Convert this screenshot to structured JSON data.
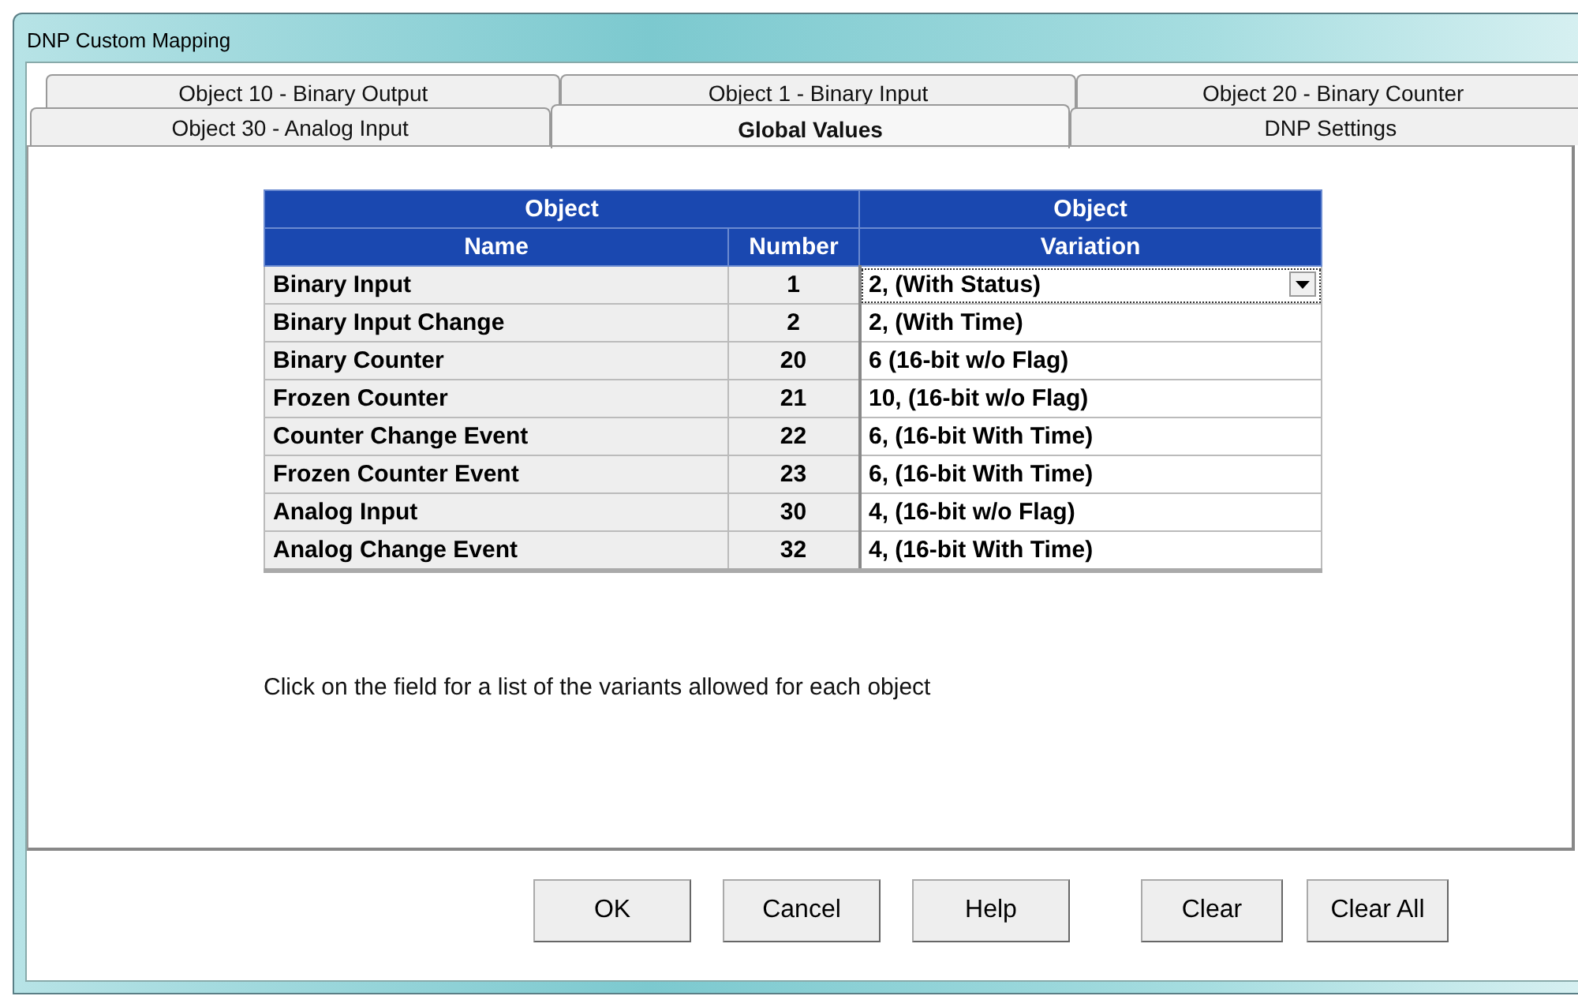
{
  "window": {
    "title": "DNP Custom Mapping"
  },
  "tab_rows": [
    [
      {
        "label": "Object 10 - Binary Output",
        "selected": false
      },
      {
        "label": "Object 1 - Binary Input",
        "selected": false
      },
      {
        "label": "Object 20 - Binary Counter",
        "selected": false
      }
    ],
    [
      {
        "label": "Object 30 - Analog Input",
        "selected": false
      },
      {
        "label": "Global Values",
        "selected": true
      },
      {
        "label": "DNP Settings",
        "selected": false
      }
    ]
  ],
  "table": {
    "group_headers": [
      "Object",
      "Object"
    ],
    "columns": [
      "Name",
      "Number",
      "Variation"
    ],
    "rows": [
      {
        "name": "Binary Input",
        "number": "1",
        "variation": "2, (With Status)",
        "kind": "dropdown"
      },
      {
        "name": "Binary Input Change",
        "number": "2",
        "variation": "2, (With Time)",
        "kind": "text"
      },
      {
        "name": "Binary Counter",
        "number": "20",
        "variation": "6 (16-bit w/o Flag)",
        "kind": "text"
      },
      {
        "name": "Frozen Counter",
        "number": "21",
        "variation": "10, (16-bit w/o Flag)",
        "kind": "text"
      },
      {
        "name": "Counter Change Event",
        "number": "22",
        "variation": "6, (16-bit With Time)",
        "kind": "text"
      },
      {
        "name": "Frozen Counter Event",
        "number": "23",
        "variation": "6, (16-bit With Time)",
        "kind": "text"
      },
      {
        "name": "Analog Input",
        "number": "30",
        "variation": "4, (16-bit w/o Flag)",
        "kind": "text"
      },
      {
        "name": "Analog Change Event",
        "number": "32",
        "variation": "4, (16-bit With Time)",
        "kind": "text"
      }
    ]
  },
  "hint": "Click on the field for a list of the variants allowed for each object",
  "button_groups": [
    [
      "OK",
      "Cancel",
      "Help"
    ],
    [
      "Clear",
      "Clear All"
    ]
  ]
}
